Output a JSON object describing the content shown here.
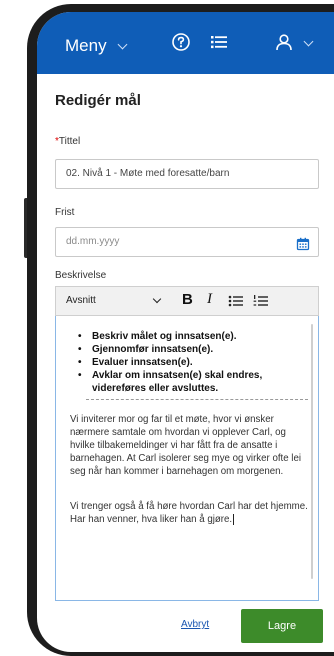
{
  "topbar": {
    "menu_label": "Meny",
    "help_icon": "help-circle-icon",
    "list_icon": "list-icon",
    "user_icon": "user-icon",
    "color": "#0f5db7"
  },
  "form": {
    "title": "Redigér mål",
    "title_field": {
      "required_mark": "*",
      "label": "Tittel",
      "value": "02. Nivå 1 - Møte med foresatte/barn"
    },
    "deadline_field": {
      "label": "Frist",
      "placeholder": "dd.mm.yyyy",
      "icon": "calendar-icon"
    },
    "description": {
      "label": "Beskrivelse",
      "toolbar": {
        "style_select": "Avsnitt",
        "bold": "B",
        "italic": "I",
        "bullet_list_icon": "bullet-list-icon",
        "numbered_list_icon": "numbered-list-icon"
      },
      "bullets": [
        "Beskriv målet og innsatsen(e).",
        "Gjennomfør innsatsen(e).",
        "Evaluer innsatsen(e).",
        "Avklar om innsatsen(e) skal endres, videreføres eller avsluttes."
      ],
      "paragraphs": [
        "Vi inviterer mor og far til et møte, hvor vi ønsker nærmere samtale om hvordan vi opplever Carl, og hvilke tilbakemeldinger vi har fått fra de ansatte i barnehagen.  At Carl isolerer seg mye og virker ofte lei seg når han kommer i barnehagen om morgenen.",
        "Vi trenger også å få høre hvordan Carl har det hjemme.  Har han venner, hva liker han å gjøre."
      ]
    },
    "cancel_label": "Avbryt",
    "save_label": "Lagre",
    "save_color": "#3d8b2a"
  }
}
